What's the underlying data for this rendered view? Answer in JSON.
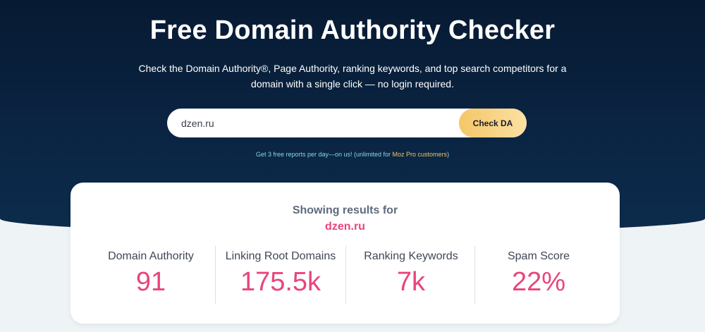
{
  "header": {
    "title": "Free Domain Authority Checker",
    "subtitle": "Check the Domain Authority®, Page Authority, ranking keywords, and top search competitors for a domain with a single click — no login required."
  },
  "search": {
    "value": "dzen.ru",
    "button_label": "Check DA"
  },
  "note": {
    "prefix": "Get 3 free reports per day—on us! (unlimited for ",
    "link_text": "Moz Pro customers",
    "suffix": ")"
  },
  "results": {
    "showing_label": "Showing results for",
    "domain": "dzen.ru",
    "metrics": [
      {
        "label": "Domain Authority",
        "value": "91"
      },
      {
        "label": "Linking Root Domains",
        "value": "175.5k"
      },
      {
        "label": "Ranking Keywords",
        "value": "7k"
      },
      {
        "label": "Spam Score",
        "value": "22%"
      }
    ]
  },
  "colors": {
    "hero_background": "#0b2746",
    "accent_pink": "#e8457c",
    "button_gold": "#f4c668",
    "note_cyan": "#8ad4e6"
  }
}
